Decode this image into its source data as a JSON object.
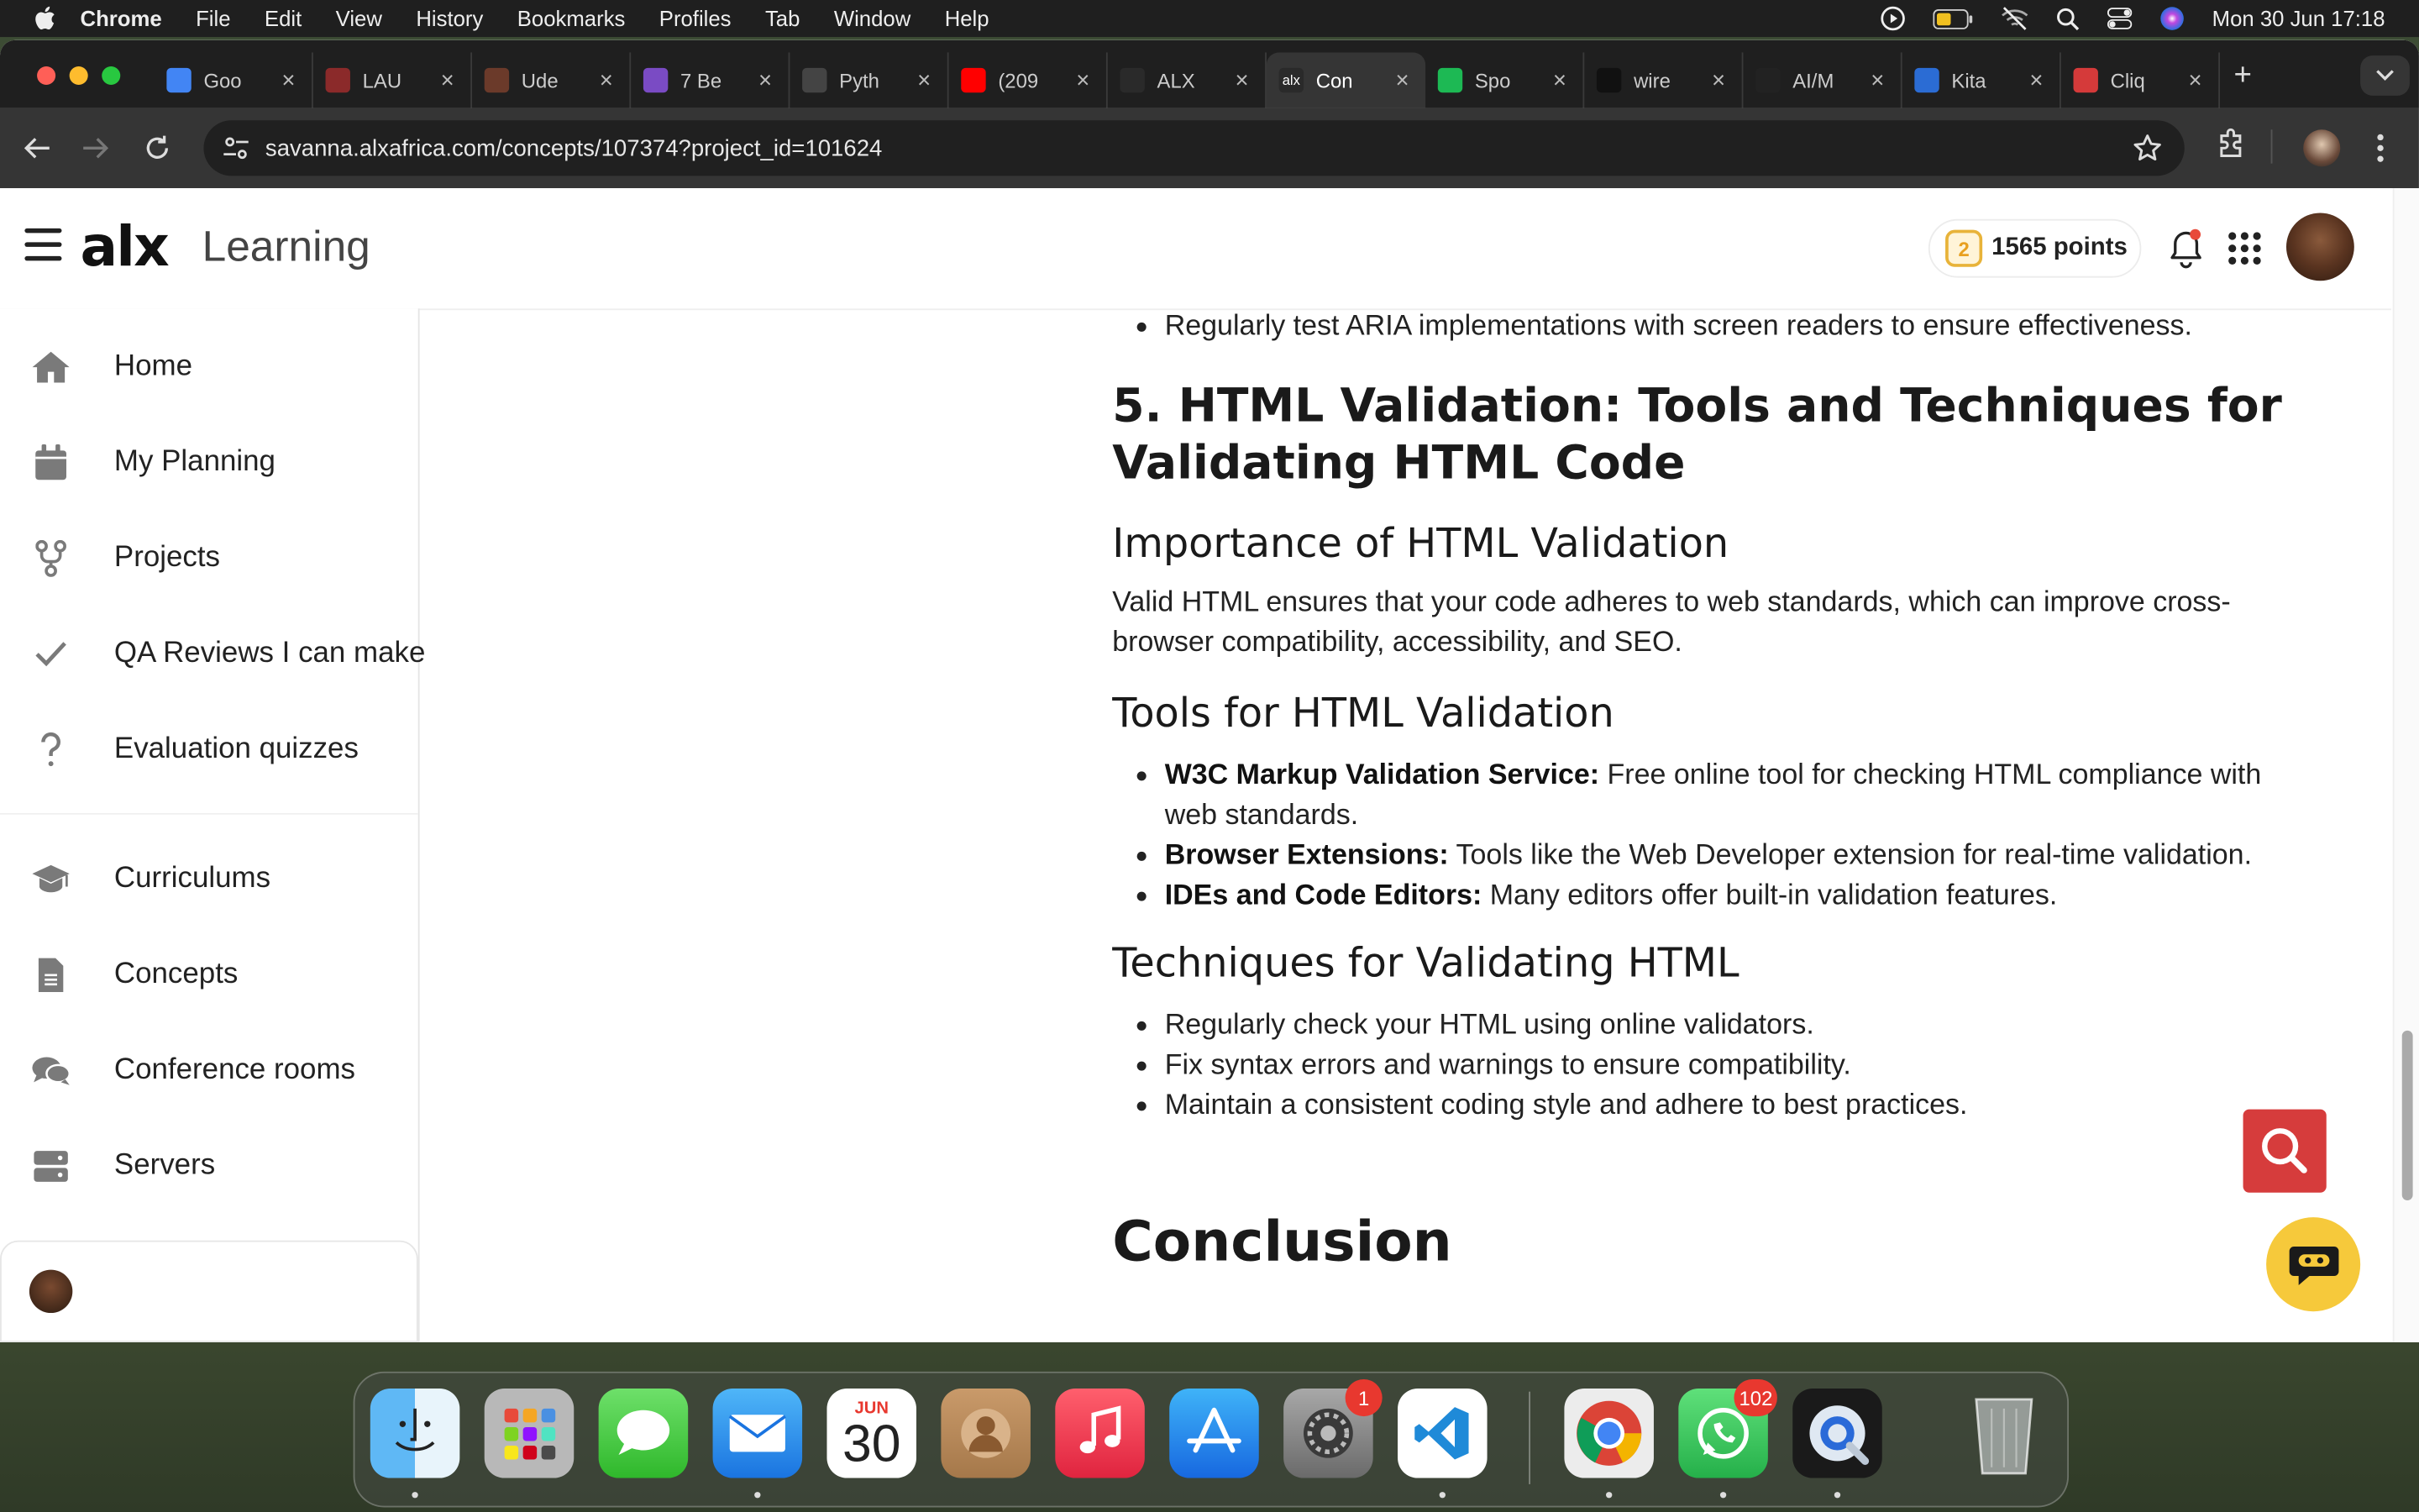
{
  "menubar": {
    "app_name": "Chrome",
    "items": [
      "File",
      "Edit",
      "View",
      "History",
      "Bookmarks",
      "Profiles",
      "Tab",
      "Window",
      "Help"
    ],
    "datetime": "Mon 30 Jun  17:18"
  },
  "browser": {
    "tabs": [
      {
        "title": "Goo",
        "favicon_color": "#4285f4"
      },
      {
        "title": "LAU",
        "favicon_color": "#8b2a2a"
      },
      {
        "title": "Ude",
        "favicon_color": "#6b3a2a"
      },
      {
        "title": "7 Be",
        "favicon_color": "#7a4bc4"
      },
      {
        "title": "Pyth",
        "favicon_color": "#444444"
      },
      {
        "title": "(209",
        "favicon_color": "#ff0000"
      },
      {
        "title": "ALX",
        "favicon_color": "#2a2a2a"
      },
      {
        "title": "Con",
        "favicon_color": "#2a2a2a",
        "favicon_text": "alx",
        "active": true
      },
      {
        "title": "Spo",
        "favicon_color": "#1db954"
      },
      {
        "title": "wire",
        "favicon_color": "#111111"
      },
      {
        "title": "AI/M",
        "favicon_color": "#222222"
      },
      {
        "title": "Kita",
        "favicon_color": "#2b6cd4"
      },
      {
        "title": "Cliq",
        "favicon_color": "#d53a3a"
      }
    ],
    "url": "savanna.alxafrica.com/concepts/107374?project_id=101624"
  },
  "app": {
    "logo": "alx",
    "section": "Learning",
    "points": "1565 points",
    "sidebar": [
      {
        "label": "Home",
        "icon": "home-icon"
      },
      {
        "label": "My Planning",
        "icon": "calendar-icon"
      },
      {
        "label": "Projects",
        "icon": "fork-icon"
      },
      {
        "label": "QA Reviews I can make",
        "icon": "check-icon"
      },
      {
        "label": "Evaluation quizzes",
        "icon": "question-icon"
      },
      {
        "label": "Curriculums",
        "icon": "graduation-cap-icon"
      },
      {
        "label": "Concepts",
        "icon": "document-icon"
      },
      {
        "label": "Conference rooms",
        "icon": "chat-bubbles-icon"
      },
      {
        "label": "Servers",
        "icon": "server-icon"
      }
    ]
  },
  "article": {
    "top_bullet": "Regularly test ARIA implementations with screen readers to ensure effectiveness.",
    "section_title": "5. HTML Validation: Tools and Techniques for Validating HTML Code",
    "importance": {
      "heading": "Importance of HTML Validation",
      "text": "Valid HTML ensures that your code adheres to web standards, which can improve cross-browser compatibility, accessibility, and SEO."
    },
    "tools": {
      "heading": "Tools for HTML Validation",
      "items": [
        {
          "term": "W3C Markup Validation Service:",
          "desc": " Free online tool for checking HTML compliance with web standards."
        },
        {
          "term": "Browser Extensions:",
          "desc": " Tools like the Web Developer extension for real-time validation."
        },
        {
          "term": "IDEs and Code Editors:",
          "desc": " Many editors offer built-in validation features."
        }
      ]
    },
    "techniques": {
      "heading": "Techniques for Validating HTML",
      "items": [
        "Regularly check your HTML using online validators.",
        "Fix syntax errors and warnings to ensure compatibility.",
        "Maintain a consistent coding style and adhere to best practices."
      ]
    },
    "conclusion_heading": "Conclusion"
  },
  "dock": {
    "calendar_month": "JUN",
    "calendar_day": "30",
    "settings_badge": "1",
    "whatsapp_badge": "102"
  },
  "colors": {
    "search_fab": "#d63c3c",
    "chat_fab": "#f6c93b",
    "points_badge": "#e8b339"
  }
}
